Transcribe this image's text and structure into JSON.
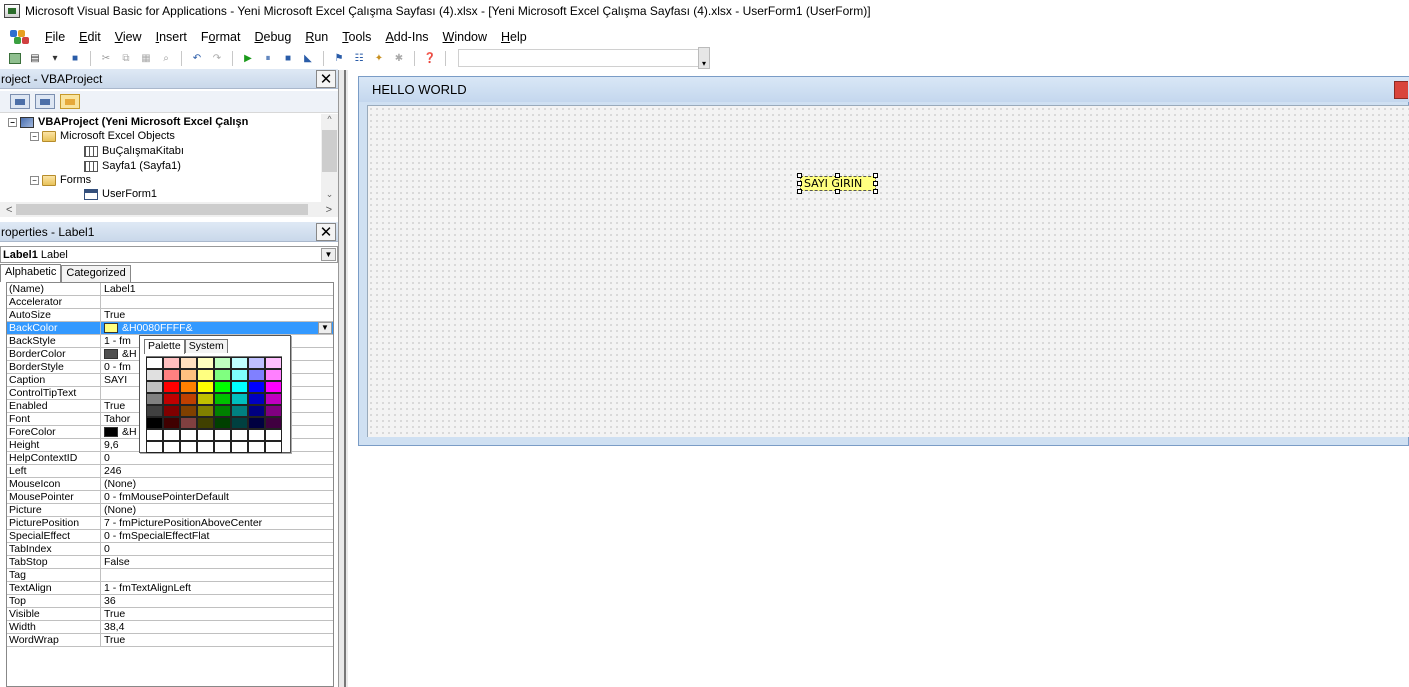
{
  "window": {
    "title": "Microsoft Visual Basic for Applications - Yeni Microsoft Excel Çalışma Sayfası (4).xlsx - [Yeni Microsoft Excel Çalışma Sayfası (4).xlsx - UserForm1 (UserForm)]"
  },
  "menu": [
    {
      "key": "F",
      "rest": "ile"
    },
    {
      "key": "E",
      "rest": "dit"
    },
    {
      "key": "V",
      "rest": "iew"
    },
    {
      "key": "I",
      "rest": "nsert"
    },
    {
      "pre": "F",
      "key": "o",
      "rest": "rmat"
    },
    {
      "key": "D",
      "rest": "ebug"
    },
    {
      "key": "R",
      "rest": "un"
    },
    {
      "key": "T",
      "rest": "ools"
    },
    {
      "key": "A",
      "rest": "dd-Ins"
    },
    {
      "key": "W",
      "rest": "indow"
    },
    {
      "key": "H",
      "rest": "elp"
    }
  ],
  "project_pane": {
    "title": "roject - VBAProject",
    "tree": {
      "root": "VBAProject (Yeni Microsoft Excel Çalışn",
      "excel_objects": "Microsoft Excel Objects",
      "workbook": "BuÇalışmaKitabı",
      "sheet1": "Sayfa1 (Sayfa1)",
      "forms": "Forms",
      "userform": "UserForm1"
    }
  },
  "properties_pane": {
    "title": "roperties - Label1",
    "object_combo": {
      "name": "Label1",
      "type": "Label"
    },
    "tabs": [
      "Alphabetic",
      "Categorized"
    ],
    "properties": [
      {
        "name": "(Name)",
        "value": "Label1"
      },
      {
        "name": "Accelerator",
        "value": ""
      },
      {
        "name": "AutoSize",
        "value": "True"
      },
      {
        "name": "BackColor",
        "value": "&H0080FFFF&",
        "swatch": "#ffff80",
        "selected": true
      },
      {
        "name": "BackStyle",
        "value": "1 - fm"
      },
      {
        "name": "BorderColor",
        "value": "&H",
        "swatch": "#505050"
      },
      {
        "name": "BorderStyle",
        "value": "0 - fm"
      },
      {
        "name": "Caption",
        "value": "SAYI"
      },
      {
        "name": "ControlTipText",
        "value": ""
      },
      {
        "name": "Enabled",
        "value": "True"
      },
      {
        "name": "Font",
        "value": "Tahor"
      },
      {
        "name": "ForeColor",
        "value": "&H",
        "swatch": "#000000"
      },
      {
        "name": "Height",
        "value": "9,6"
      },
      {
        "name": "HelpContextID",
        "value": "0"
      },
      {
        "name": "Left",
        "value": "246"
      },
      {
        "name": "MouseIcon",
        "value": "(None)"
      },
      {
        "name": "MousePointer",
        "value": "0 - fmMousePointerDefault"
      },
      {
        "name": "Picture",
        "value": "(None)"
      },
      {
        "name": "PicturePosition",
        "value": "7 - fmPicturePositionAboveCenter"
      },
      {
        "name": "SpecialEffect",
        "value": "0 - fmSpecialEffectFlat"
      },
      {
        "name": "TabIndex",
        "value": "0"
      },
      {
        "name": "TabStop",
        "value": "False"
      },
      {
        "name": "Tag",
        "value": ""
      },
      {
        "name": "TextAlign",
        "value": "1 - fmTextAlignLeft"
      },
      {
        "name": "Top",
        "value": "36"
      },
      {
        "name": "Visible",
        "value": "True"
      },
      {
        "name": "Width",
        "value": "38,4"
      },
      {
        "name": "WordWrap",
        "value": "True"
      }
    ],
    "palette": {
      "tabs": [
        "Palette",
        "System"
      ],
      "colors": [
        [
          "#ffffff",
          "#ffc0c0",
          "#ffe0c0",
          "#ffffc0",
          "#c0ffc0",
          "#c0ffff",
          "#c0c0ff",
          "#ffc0ff"
        ],
        [
          "#e0e0e0",
          "#ff8080",
          "#ffc080",
          "#ffff80",
          "#80ff80",
          "#80ffff",
          "#8080ff",
          "#ff80ff"
        ],
        [
          "#c0c0c0",
          "#ff0000",
          "#ff8000",
          "#ffff00",
          "#00ff00",
          "#00ffff",
          "#0000ff",
          "#ff00ff"
        ],
        [
          "#808080",
          "#c00000",
          "#c04000",
          "#c0c000",
          "#00c000",
          "#00c0c0",
          "#0000c0",
          "#c000c0"
        ],
        [
          "#404040",
          "#800000",
          "#804000",
          "#808000",
          "#008000",
          "#008080",
          "#000080",
          "#800080"
        ],
        [
          "#000000",
          "#400000",
          "#804040",
          "#404000",
          "#004000",
          "#004040",
          "#000040",
          "#400040"
        ],
        [
          "#ffffff",
          "#ffffff",
          "#ffffff",
          "#ffffff",
          "#ffffff",
          "#ffffff",
          "#ffffff",
          "#ffffff"
        ],
        [
          "#ffffff",
          "#ffffff",
          "#ffffff",
          "#ffffff",
          "#ffffff",
          "#ffffff",
          "#ffffff",
          "#ffffff"
        ]
      ]
    }
  },
  "userform": {
    "caption": "HELLO WORLD",
    "label_caption": "SAYI GIRIN"
  },
  "colors": {
    "selection": "#3399ff",
    "form_chrome": "#cfe0f2",
    "label_back": "#ffff80"
  }
}
